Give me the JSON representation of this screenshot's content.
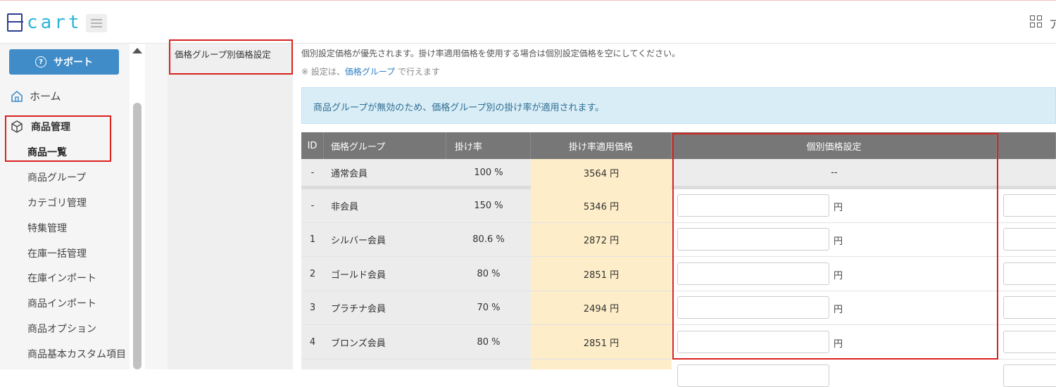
{
  "header": {
    "logo_text": "cart",
    "brand_color": "#2eb5d6",
    "menu_icon": "hamburger-icon",
    "apps_icon": "grid-icon",
    "cut_text": "ア"
  },
  "sidebar": {
    "support_label": "サポート",
    "home_label": "ホーム",
    "group_label": "商品管理",
    "items": [
      "商品一覧",
      "商品グループ",
      "カテゴリ管理",
      "特集管理",
      "在庫一括管理",
      "在庫インポート",
      "商品インポート",
      "商品オプション",
      "商品基本カスタム項目"
    ]
  },
  "section": {
    "label": "価格グループ別価格設定",
    "description": "個別設定価格が優先されます。掛け率適用価格を使用する場合は個別設定価格を空にしてください。",
    "note_prefix": "※ 設定は、",
    "note_link": "価格グループ",
    "note_suffix": " で行えます",
    "alert": "商品グループが無効のため、価格グループ別の掛け率が適用されます。"
  },
  "table": {
    "headers": [
      "ID",
      "価格グループ",
      "掛け率",
      "掛け率適用価格",
      "個別価格設定"
    ],
    "rows": [
      {
        "id": "-",
        "group": "通常会員",
        "rate": "100 %",
        "price": "3564 円",
        "individual": "--"
      },
      {
        "id": "-",
        "group": "非会員",
        "rate": "150 %",
        "price": "5346 円",
        "unit": "円"
      },
      {
        "id": "1",
        "group": "シルバー会員",
        "rate": "80.6 %",
        "price": "2872 円",
        "unit": "円"
      },
      {
        "id": "2",
        "group": "ゴールド会員",
        "rate": "80 %",
        "price": "2851 円",
        "unit": "円"
      },
      {
        "id": "3",
        "group": "プラチナ会員",
        "rate": "70 %",
        "price": "2494 円",
        "unit": "円"
      },
      {
        "id": "4",
        "group": "ブロンズ会員",
        "rate": "80 %",
        "price": "2851 円",
        "unit": "円"
      }
    ]
  },
  "colors": {
    "highlight": "#d9221e",
    "header_bg": "#777777",
    "price_bg": "#fdedc8",
    "alert_bg": "#d9edf7"
  }
}
